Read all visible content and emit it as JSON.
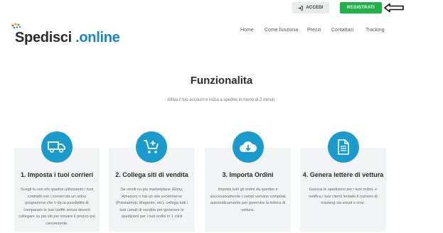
{
  "header": {
    "accedi_label": "ACCEDI",
    "registrati_label": "REGISTRATI"
  },
  "logo": {
    "first": "Spedisci",
    "second": ".online"
  },
  "nav": {
    "items": [
      "Home",
      "Come funziona",
      "Prezzi",
      "Contattaci",
      "Tracking"
    ]
  },
  "main": {
    "title": "Funzionalita",
    "subtitle": "Attiva il tuo account e inizia a spedire in meno di 2 minuti."
  },
  "features": [
    {
      "icon": "truck-icon",
      "title": "1. Imposta i tuoi corrieri",
      "text": "Scegli tu con chi spedire utilizzando i tuoi contratti con i corrieri da un unico programma che ti da la possibilità di comparare le tuoi tariffe senza doverti collegare su più siti per trovare il prezzo più conveniente."
    },
    {
      "icon": "cart-plus-icon",
      "title": "2. Collega siti di vendita",
      "text": "Se vendi su piu marketplace (Ebay, Amazon) o hai un sito ecommerce (Prestashop, Magento, etc), collega tutti i tuoi canali di vendita per generare le spedizioni per i tuoi ordini in 1 click"
    },
    {
      "icon": "cloud-download-icon",
      "title": "3. Importa Ordini",
      "text": "Importa tutti gli ordini da spedire e successivamente i campi verrano compilati automaticamente per generare la lettera di vettura."
    },
    {
      "icon": "document-icon",
      "title": "4. Genera lettere di vettura",
      "text": "Genera le spedizioni per i tuoi ordini, e notifica i tuoi clienti inviado il numero di tracking via email o sms."
    }
  ],
  "colors": {
    "accent_blue": "#1a9bcb",
    "green_button": "#1fb24b",
    "logo_online": "#1d84c4",
    "card_bg": "#f3f4f6"
  }
}
